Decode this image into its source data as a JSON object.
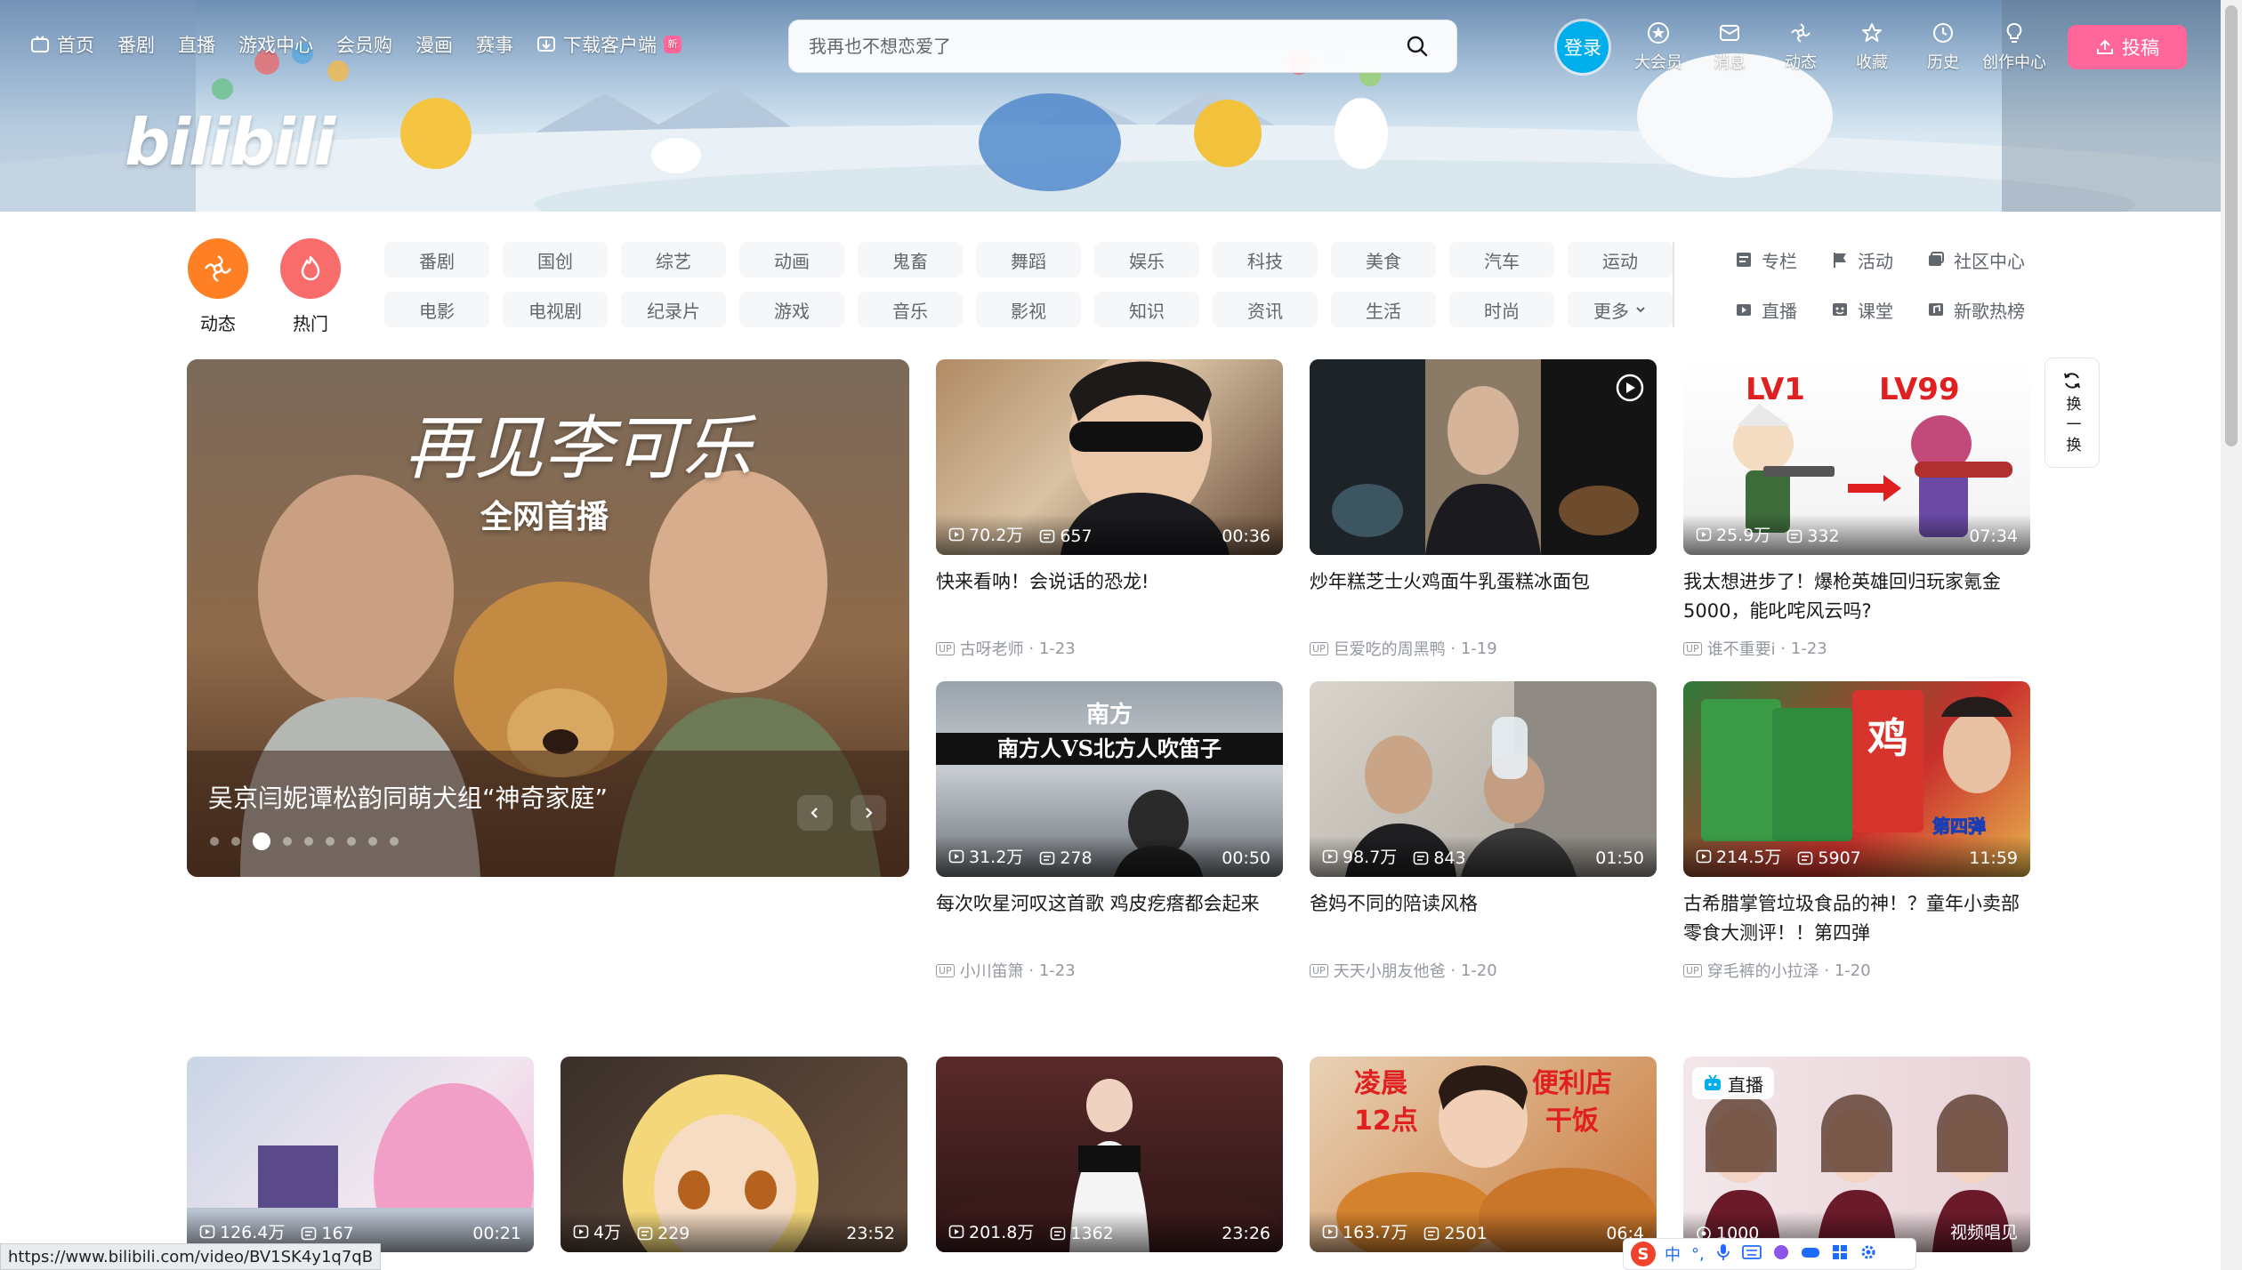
{
  "logo": "bilibili",
  "nav_left": [
    {
      "label": "首页",
      "icon": "tv-icon"
    },
    {
      "label": "番剧"
    },
    {
      "label": "直播"
    },
    {
      "label": "游戏中心"
    },
    {
      "label": "会员购"
    },
    {
      "label": "漫画"
    },
    {
      "label": "赛事"
    },
    {
      "label": "下载客户端",
      "icon": "download-icon",
      "badge": "新"
    }
  ],
  "search": {
    "placeholder": "我再也不想恋爱了"
  },
  "nav_right": {
    "login": "登录",
    "items": [
      {
        "label": "大会员",
        "icon": "vip-icon"
      },
      {
        "label": "消息",
        "icon": "message-icon"
      },
      {
        "label": "动态",
        "icon": "dynamic-icon"
      },
      {
        "label": "收藏",
        "icon": "star-icon"
      },
      {
        "label": "历史",
        "icon": "history-icon"
      },
      {
        "label": "创作中心",
        "icon": "bulb-icon"
      }
    ],
    "upload": "投稿"
  },
  "round_channels": [
    {
      "label": "动态",
      "color": "#ff7f24"
    },
    {
      "label": "热门",
      "color": "#f96c6c"
    }
  ],
  "channels": [
    "番剧",
    "国创",
    "综艺",
    "动画",
    "鬼畜",
    "舞蹈",
    "娱乐",
    "科技",
    "美食",
    "汽车",
    "运动",
    "电影",
    "电视剧",
    "纪录片",
    "游戏",
    "音乐",
    "影视",
    "知识",
    "资讯",
    "生活",
    "时尚",
    "更多"
  ],
  "channel_links": [
    {
      "label": "专栏",
      "icon": "column-icon"
    },
    {
      "label": "活动",
      "icon": "flag-icon"
    },
    {
      "label": "社区中心",
      "icon": "community-icon"
    },
    {
      "label": "直播",
      "icon": "live-icon"
    },
    {
      "label": "课堂",
      "icon": "class-icon"
    },
    {
      "label": "新歌热榜",
      "icon": "music-chart-icon"
    }
  ],
  "carousel": {
    "title": "吴京闫妮谭松韵同萌犬组“神奇家庭”",
    "overlay_title": "再见李可乐",
    "overlay_sub": "全网首播",
    "dots": 9,
    "active_dot": 2
  },
  "refresh": {
    "label": "换一换"
  },
  "videos": [
    {
      "title": "快来看呐！会说话的恐龙!",
      "views": "70.2万",
      "danmaku": "657",
      "duration": "00:36",
      "author": "古呀老师",
      "date": "1-23"
    },
    {
      "title": "炒年糕芝士火鸡面牛乳蛋糕冰面包",
      "views": "",
      "danmaku": "",
      "duration": "",
      "author": "巨爱吃的周黑鸭",
      "date": "1-19"
    },
    {
      "title": "我太想进步了！爆枪英雄回归玩家氪金5000，能叱咤风云吗?",
      "views": "25.9万",
      "danmaku": "332",
      "duration": "07:34",
      "author": "谁不重要i",
      "date": "1-23"
    },
    {
      "title": "每次吹星河叹这首歌 鸡皮疙瘩都会起来",
      "views": "31.2万",
      "danmaku": "278",
      "duration": "00:50",
      "author": "小川笛箫",
      "date": "1-23"
    },
    {
      "title": "爸妈不同的陪读风格",
      "views": "98.7万",
      "danmaku": "843",
      "duration": "01:50",
      "author": "天天小朋友他爸",
      "date": "1-20"
    },
    {
      "title": "古希腊掌管垃圾食品的神！？童年小卖部零食大测评！！第四弹",
      "views": "214.5万",
      "danmaku": "5907",
      "duration": "11:59",
      "author": "穿毛裤的小拉泽",
      "date": "1-20"
    }
  ],
  "videos_row3": [
    {
      "views": "126.4万",
      "danmaku": "167",
      "duration": "00:21"
    },
    {
      "views": "4万",
      "danmaku": "229",
      "duration": "23:52"
    },
    {
      "views": "201.8万",
      "danmaku": "1362",
      "duration": "23:26"
    },
    {
      "views": "163.7万",
      "danmaku": "2501",
      "duration": "06:4"
    },
    {
      "views": "1000",
      "danmaku": "",
      "duration": "视频唱见",
      "live_label": "直播"
    }
  ],
  "thumb_texts": {
    "v3_a": "LV1",
    "v3_b": "LV99",
    "v4_a": "南方",
    "v4_b": "南方人VS北方人吹笛子",
    "v6_a": "鸡",
    "v6_b": "第四弹",
    "r4_a": "凌晨",
    "r4_b": "12点",
    "r4_c": "便利店",
    "r4_d": "干饭"
  },
  "statusbar": "https://www.bilibili.com/video/BV1SK4y1q7qB",
  "ime": {
    "logo": "S",
    "lang": "中"
  }
}
